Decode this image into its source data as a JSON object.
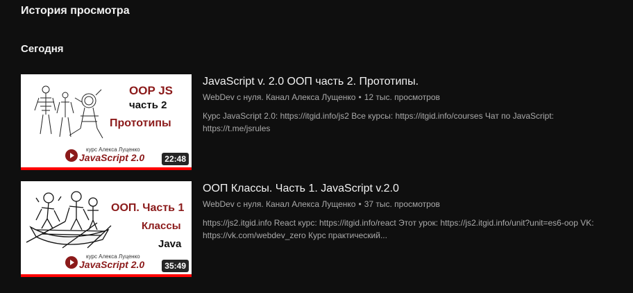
{
  "page": {
    "title": "История просмотра",
    "section": "Сегодня"
  },
  "videos": [
    {
      "title": "JavaScript v. 2.0 ООП часть 2. Прототипы.",
      "channel": "WebDev с нуля. Канал Алекса Лущенко",
      "views": "12 тыс. просмотров",
      "description": "Курс JavaScript 2.0: https://itgid.info/js2 Все курсы: https://itgid.info/courses Чат по JavaScript: https://t.me/jsrules",
      "duration": "22:48",
      "thumb": {
        "line1": "OOP JS",
        "line2": "часть 2",
        "line3": "Прототипы",
        "author": "курс Алекса Луценко",
        "brand": "JavaScript 2.0"
      }
    },
    {
      "title": "ООП Классы. Часть 1. JavaScript v.2.0",
      "channel": "WebDev с нуля. Канал Алекса Лущенко",
      "views": "37 тыс. просмотров",
      "description": "https://js2.itgid.info React курс: https://itgid.info/react Этот урок: https://js2.itgid.info/unit?unit=es6-oop VK: https://vk.com/webdev_zero Курс практический...",
      "duration": "35:49",
      "thumb": {
        "line1": "ООП. Часть 1",
        "line2": "Классы",
        "line3": "Java",
        "author": "курс Алекса Луценко",
        "brand": "JavaScript 2.0"
      }
    }
  ],
  "colors": {
    "background": "#0f0f0f",
    "accent_red": "#ff0000",
    "thumb_text_red": "#8b1a1a",
    "secondary_text": "#aaaaaa"
  }
}
